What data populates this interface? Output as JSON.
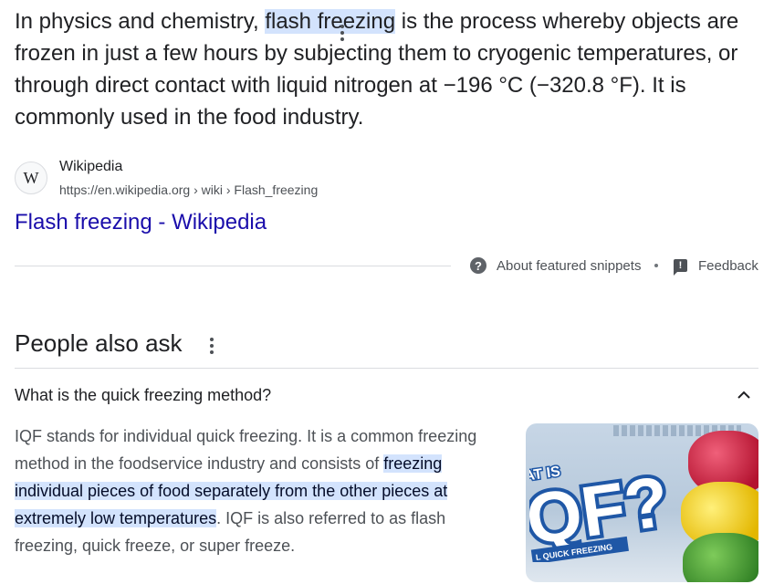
{
  "snippet": {
    "part1": "In physics and chemistry, ",
    "highlight": "flash freezing",
    "part2": " is the process whereby objects are frozen in just a few hours by subjecting them to cryogenic temperatures, or through direct contact with liquid nitrogen at −196 °C (−320.8 °F). It is commonly used in the food industry."
  },
  "source": {
    "favicon": "W",
    "name": "Wikipedia",
    "url": "https://en.wikipedia.org › wiki › Flash_freezing",
    "title": "Flash freezing - Wikipedia"
  },
  "meta": {
    "about_label": "About featured snippets",
    "feedback_label": "Feedback",
    "about_icon": "help-icon",
    "feedback_icon": "feedback-icon"
  },
  "paa": {
    "title": "People also ask",
    "question": "What is the quick freezing method?",
    "answer": {
      "part1": "IQF stands for individual quick freezing. It is a common freezing method in the foodservice industry and consists of ",
      "highlight": "freezing individual pieces of food separately from the other pieces at extremely low temperatures",
      "part2": ". IQF is also referred to as flash freezing, quick freeze, or super freeze."
    },
    "thumbnail": {
      "line1": "AT IS",
      "big": "QF?",
      "banner": "L QUICK FREEZING"
    }
  },
  "colors": {
    "link": "#1a0dab",
    "highlight": "#d3e3fd",
    "text": "#202124",
    "muted": "#4d5156"
  }
}
